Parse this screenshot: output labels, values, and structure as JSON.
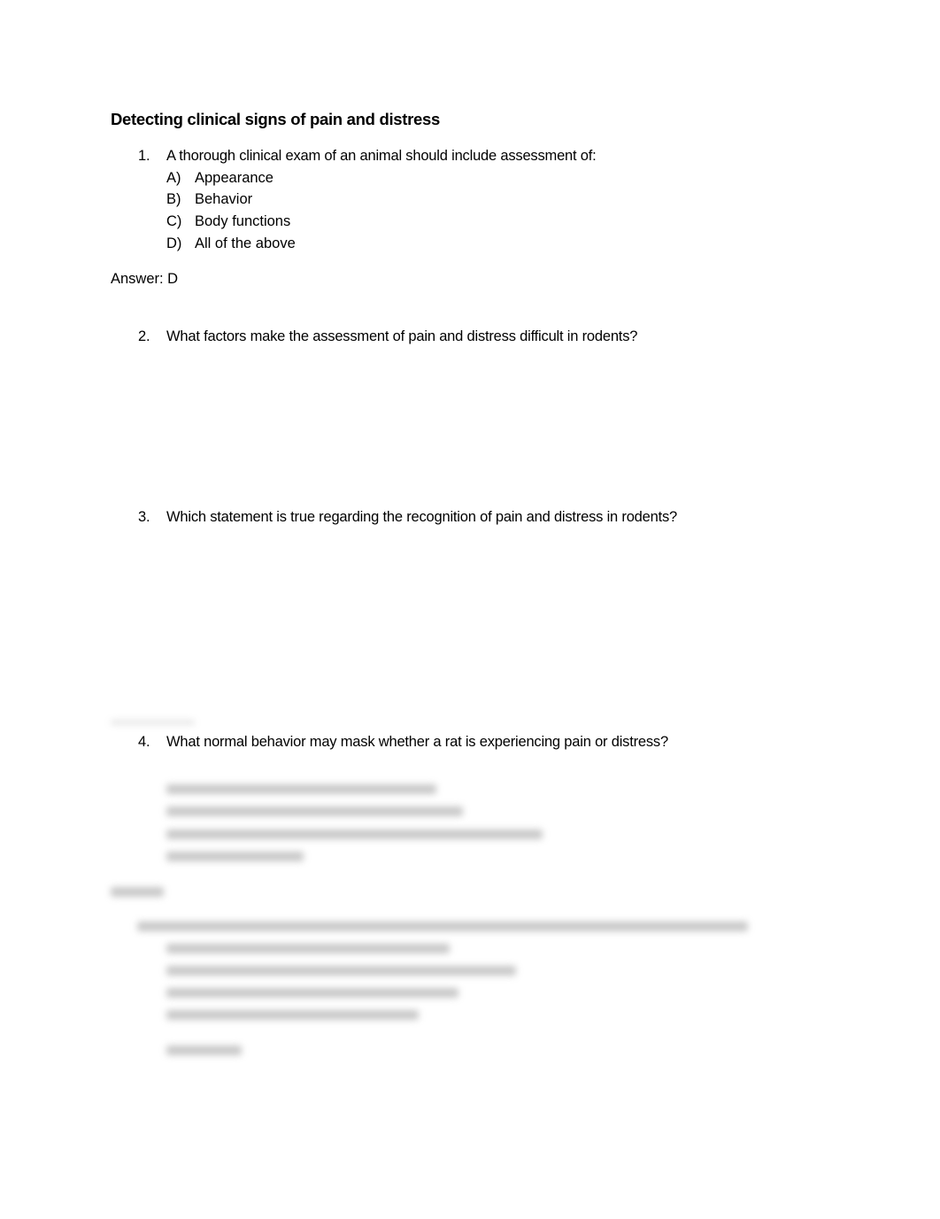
{
  "document": {
    "title": "Detecting clinical signs of pain and distress",
    "questions": [
      {
        "number": "1.",
        "text": "A thorough clinical exam of an animal should include assessment of:",
        "options": [
          {
            "letter": "A)",
            "text": "Appearance"
          },
          {
            "letter": "B)",
            "text": "Behavior"
          },
          {
            "letter": "C)",
            "text": "Body functions"
          },
          {
            "letter": "D)",
            "text": "All of the above"
          }
        ],
        "answer": "Answer: D"
      },
      {
        "number": "2.",
        "text": "What factors make the assessment of pain and distress difficult in rodents?"
      },
      {
        "number": "3.",
        "text": "Which statement is true regarding the recognition of pain and distress in rodents?"
      },
      {
        "number": "4.",
        "text": "What normal behavior may mask whether a rat is experiencing pain or distress?"
      }
    ],
    "obscured_content_note": "Remaining content blurred / not legible"
  }
}
